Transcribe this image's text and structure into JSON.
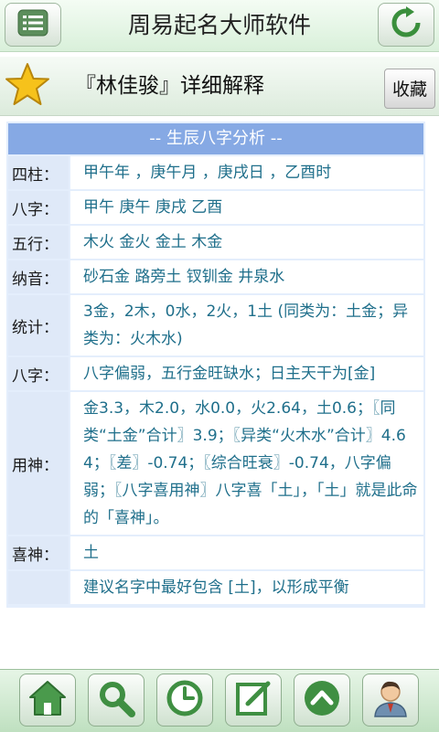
{
  "app_title": "周易起名大师软件",
  "header": {
    "name_title": "『林佳骏』详细解释",
    "favorite_label": "收藏"
  },
  "section": {
    "title": "-- 生辰八字分析 --",
    "rows": [
      {
        "label": "四柱：",
        "value": "甲午年 ，庚午月 ，庚戌日 ，乙酉时"
      },
      {
        "label": "八字：",
        "value": "甲午 庚午 庚戌 乙酉"
      },
      {
        "label": "五行：",
        "value": "木火 金火 金土 木金"
      },
      {
        "label": "纳音：",
        "value": "砂石金 路旁土 钗钏金 井泉水"
      },
      {
        "label": "统计：",
        "value": "3金，2木，0水，2火，1土 (同类为：土金；异类为：火木水)"
      },
      {
        "label": "八字：",
        "value": "八字偏弱，五行金旺缺水；日主天干为[金]"
      },
      {
        "label": "用神：",
        "value": "金3.3，木2.0，水0.0，火2.64，土0.6；〖同类“土金”合计〗3.9；〖异类“火木水”合计〗4.64；〖差〗-0.74；〖综合旺衰〗-0.74，八字偏弱；〖八字喜用神〗八字喜「土」，「土」就是此命的「喜神」。"
      },
      {
        "label": "喜神：",
        "value": "土"
      },
      {
        "label": "",
        "value": "建议名字中最好包含 [土]，以形成平衡"
      }
    ]
  },
  "icons": {
    "menu": "list-icon",
    "refresh": "refresh-icon",
    "star": "star-icon",
    "home": "home-icon",
    "search": "search-icon",
    "history": "clock-icon",
    "edit": "edit-icon",
    "up": "chevron-up-icon",
    "user": "user-icon"
  },
  "colors": {
    "accent_green": "#3a8f3c",
    "section_header": "#86a9e4",
    "value_text": "#1f6f8b",
    "star": "#f6c21b"
  }
}
